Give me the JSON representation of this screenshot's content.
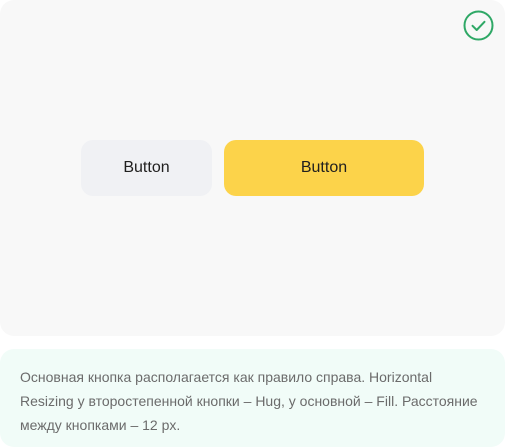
{
  "preview": {
    "status_icon": "check-circle-icon",
    "status_color": "#2fa866",
    "secondary_button": {
      "label": "Button",
      "background": "#f0f1f4"
    },
    "primary_button": {
      "label": "Button",
      "background": "#fcd34a"
    }
  },
  "note": {
    "text": "Основная кнопка располагается как правило справа. Horizontal Resizing у второстепенной кнопки – Hug, у основной – Fill. Расстояние между кнопками – 12 px."
  }
}
